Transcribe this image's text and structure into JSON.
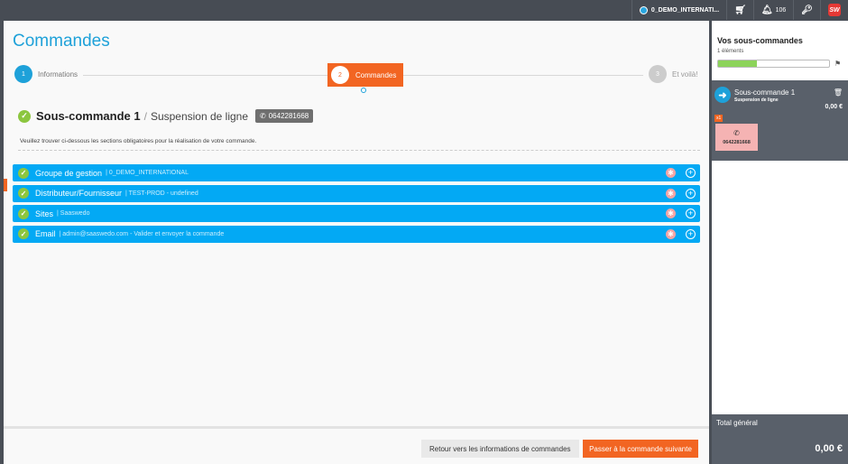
{
  "topbar": {
    "org": "0_DEMO_INTERNATI...",
    "notifications": "106",
    "icons": [
      "cart-icon",
      "bell-icon",
      "key-icon",
      "logo"
    ]
  },
  "page": {
    "title": "Commandes"
  },
  "stepper": {
    "steps": [
      {
        "num": "1",
        "label": "Informations"
      },
      {
        "num": "2",
        "label": "Commandes"
      },
      {
        "num": "3",
        "label": "Et voilà!"
      }
    ],
    "active_index": 1
  },
  "subcommand": {
    "title": "Sous-commande 1",
    "separator": "/",
    "subtitle": "Suspension de ligne",
    "phone": "0642281668",
    "instructions": "Veuillez trouver ci-dessous les sections obligatoires pour la réalisation de votre commande."
  },
  "sections": [
    {
      "title": "Groupe de gestion",
      "detail": "| 0_DEMO_INTERNATIONAL"
    },
    {
      "title": "Distributeur/Fournisseur",
      "detail": "| TEST-PROD - undefined"
    },
    {
      "title": "Sites",
      "detail": "| Saaswedo"
    },
    {
      "title": "Email",
      "detail": "| admin@saaswedo.com - Valider et envoyer la commande"
    }
  ],
  "footer": {
    "back_label": "Retour vers les informations de commandes",
    "next_label": "Passer à la commande suivante"
  },
  "sidebar": {
    "title": "Vos sous-commandes",
    "count": "1 éléments",
    "progress": 0.35,
    "card": {
      "title": "Sous-commande 1",
      "subtitle": "Suspension de ligne",
      "total": "0,00 €",
      "badge": "x1",
      "line_number": "0642281668"
    },
    "grand_total_label": "Total général",
    "grand_total": "0,00 €"
  },
  "colors": {
    "accent_blue": "#1ea1d9",
    "section_blue": "#03a9f4",
    "accent_orange": "#f26522",
    "success_green": "#8cc63f"
  }
}
